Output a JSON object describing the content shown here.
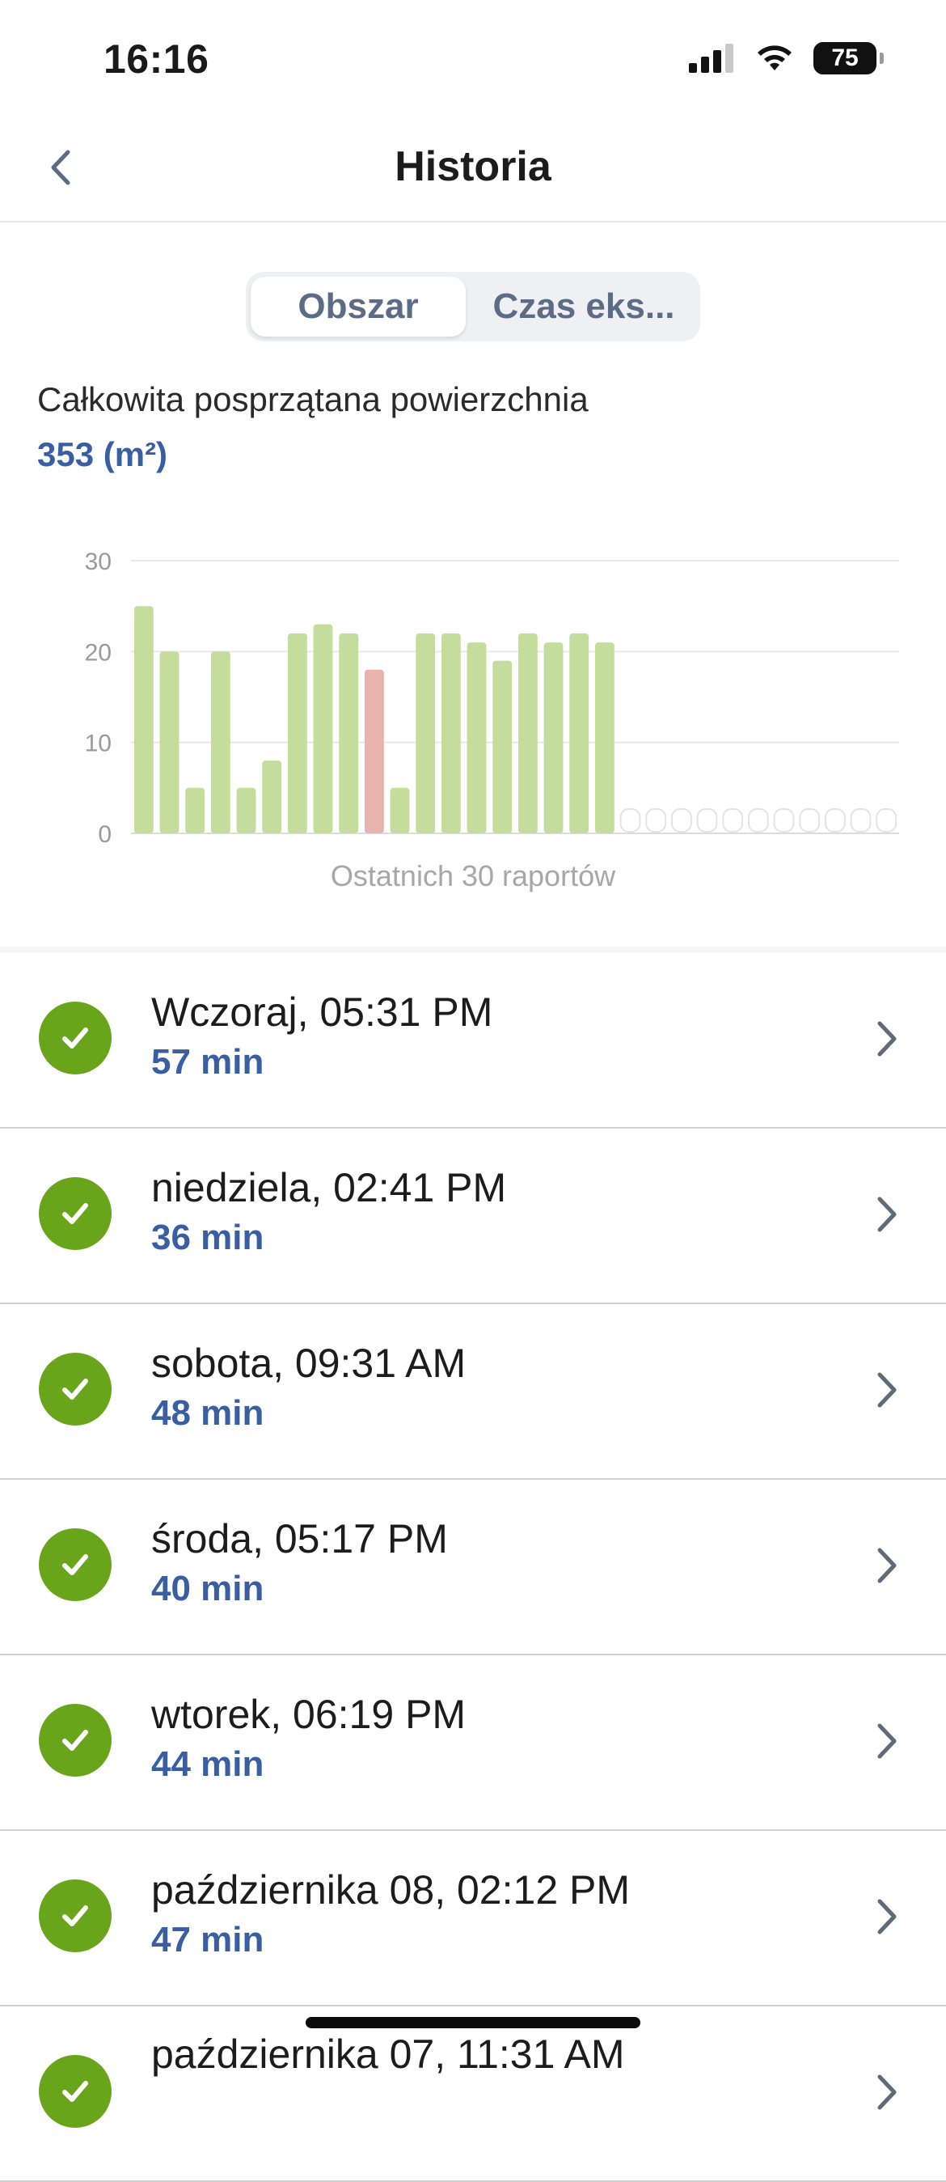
{
  "status_bar": {
    "time": "16:16",
    "battery": "75",
    "icons": [
      "signal-icon",
      "wifi-icon",
      "battery-icon"
    ]
  },
  "nav": {
    "title": "Historia",
    "back_icon": "chevron-left-icon"
  },
  "segmented": {
    "items": [
      "Obszar",
      "Czas eks..."
    ],
    "selected": "Obszar"
  },
  "summary": {
    "label": "Całkowita posprzątana powierzchnia",
    "value": "353 (m²)"
  },
  "chart_data": {
    "type": "bar",
    "xlabel": "Ostatnich 30 raportów",
    "ylim": [
      0,
      30
    ],
    "yticks": [
      "0",
      "10",
      "20",
      "30"
    ],
    "grid": true,
    "values": [
      25,
      20,
      5,
      20,
      5,
      8,
      22,
      23,
      22,
      18,
      5,
      22,
      22,
      21,
      19,
      22,
      21,
      22,
      21
    ],
    "highlight_index": 9,
    "total_slots": 30,
    "colors": {
      "normal": "#c4dc9c",
      "highlight": "#e8b3ac",
      "empty_outline": "#e3e3e3",
      "grid": "#e8e8e8"
    }
  },
  "reports": [
    {
      "title": "Wczoraj, 05:31 PM",
      "duration": "57 min"
    },
    {
      "title": "niedziela, 02:41 PM",
      "duration": "36 min"
    },
    {
      "title": "sobota, 09:31 AM",
      "duration": "48 min"
    },
    {
      "title": "środa, 05:17 PM",
      "duration": "40 min"
    },
    {
      "title": "wtorek, 06:19 PM",
      "duration": "44 min"
    },
    {
      "title": "października 08, 02:12 PM",
      "duration": "47 min"
    },
    {
      "title": "października 07, 11:31 AM",
      "duration": ""
    }
  ],
  "colors": {
    "accent_blue": "#3a5ea2",
    "success_green": "#68a51a"
  }
}
